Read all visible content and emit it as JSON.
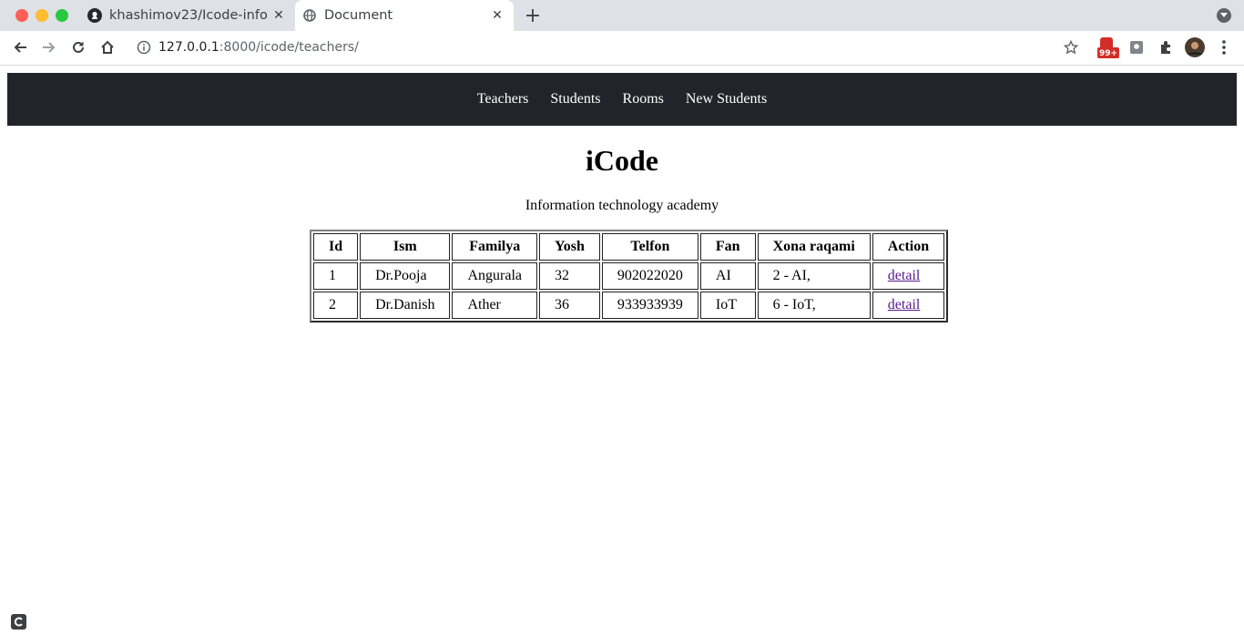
{
  "browser": {
    "tabs": [
      {
        "title": "khashimov23/Icode-info",
        "icon": "github-icon"
      },
      {
        "title": "Document",
        "icon": "globe-icon"
      }
    ],
    "url_host": "127.0.0.1",
    "url_rest": ":8000/icode/teachers/",
    "badge_count": "99+"
  },
  "nav": {
    "items": [
      "Teachers",
      "Students",
      "Rooms",
      "New Students"
    ]
  },
  "page": {
    "title": "iCode",
    "subtitle": "Information technology academy"
  },
  "table": {
    "headers": [
      "Id",
      "Ism",
      "Familya",
      "Yosh",
      "Telfon",
      "Fan",
      "Xona raqami",
      "Action"
    ],
    "rows": [
      [
        "1",
        "Dr.Pooja",
        "Angurala",
        "32",
        "902022020",
        "AI",
        "2 - AI,",
        "detail"
      ],
      [
        "2",
        "Dr.Danish",
        "Ather",
        "36",
        "933933939",
        "IoT",
        "6 - IoT,",
        "detail"
      ]
    ]
  },
  "colors": {
    "navbar_bg": "#212529",
    "link_visited": "#551a8b"
  }
}
